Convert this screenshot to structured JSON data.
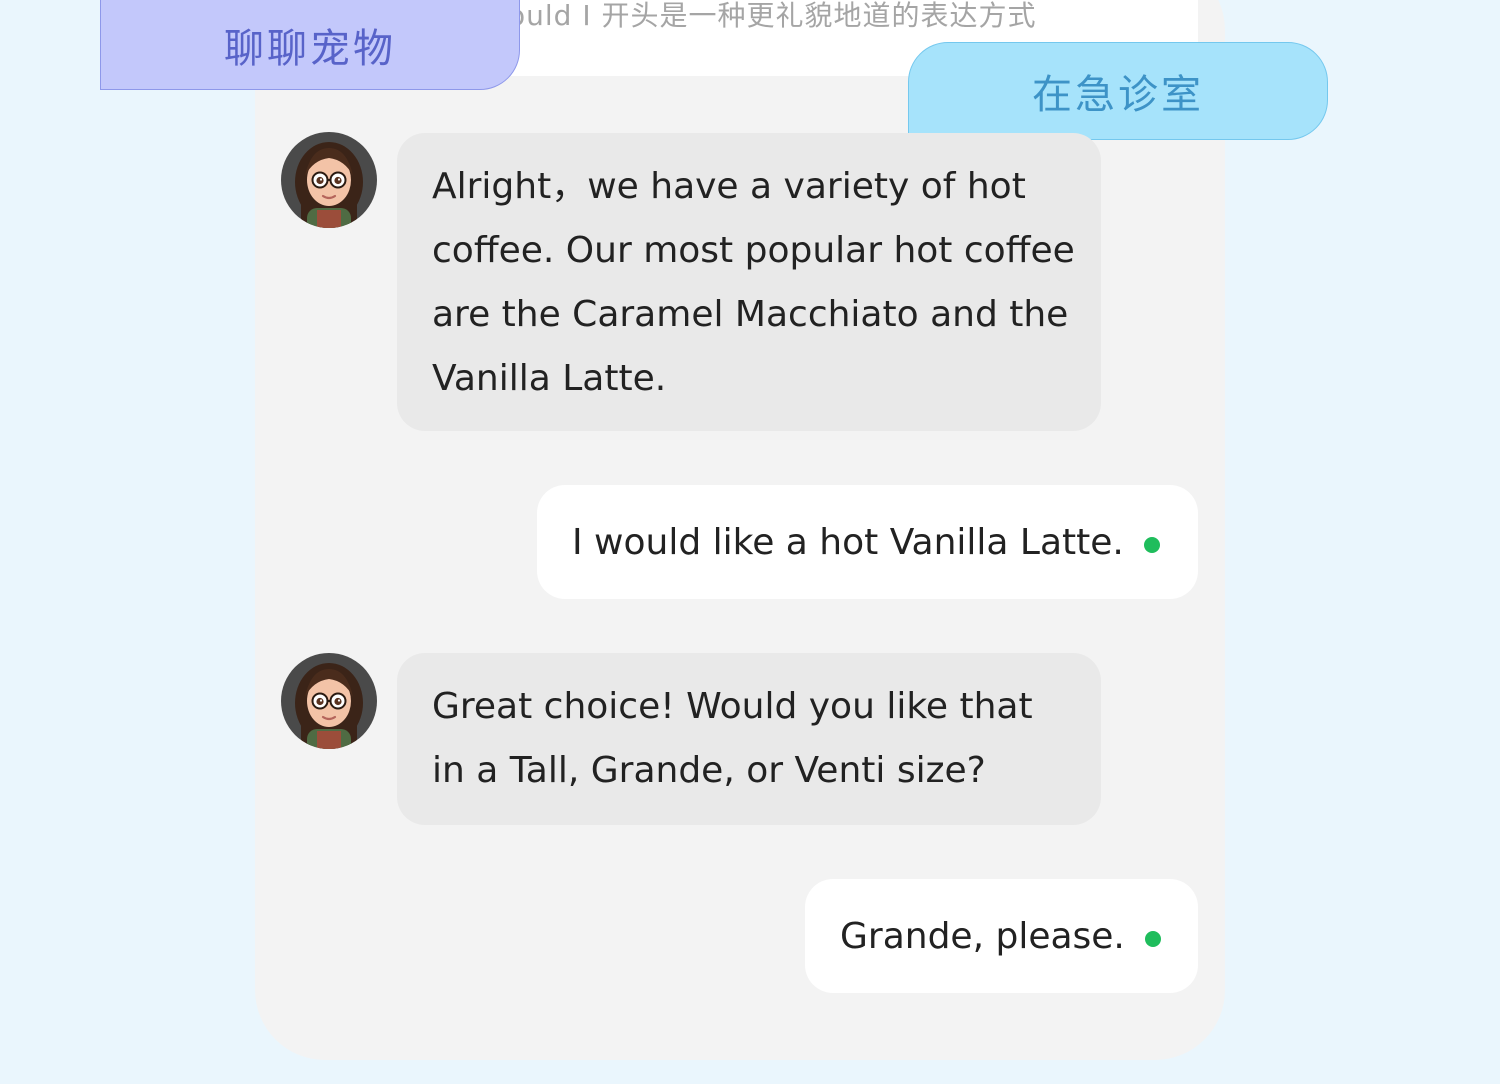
{
  "header": {
    "preview_text": "ould I 开头是一种更礼貌地道的表达方式",
    "tags": [
      {
        "label": "聊聊宠物"
      },
      {
        "label": "在急诊室"
      }
    ]
  },
  "messages": [
    {
      "sender": "ai",
      "avatar": "girl-avatar-icon",
      "text": "Alright，we have a variety of hot coffee. Our most popular hot coffee are the Caramel Macchiato and the Vanilla Latte."
    },
    {
      "sender": "user",
      "text": "I would like a hot Vanilla Latte."
    },
    {
      "sender": "ai",
      "avatar": "girl-avatar-icon",
      "text": "Great choice! Would you like that in a Tall, Grande, or Venti size?"
    },
    {
      "sender": "user",
      "text": "Grande, please."
    }
  ],
  "colors": {
    "page_background": "#eaf6fd",
    "chat_panel": "#f3f3f3",
    "ai_bubble": "#e9e9e9",
    "user_bubble": "#ffffff",
    "sent_indicator": "#1fbd5c",
    "tag_pets": "#c3c8fb",
    "tag_er": "#a6e3fb"
  }
}
